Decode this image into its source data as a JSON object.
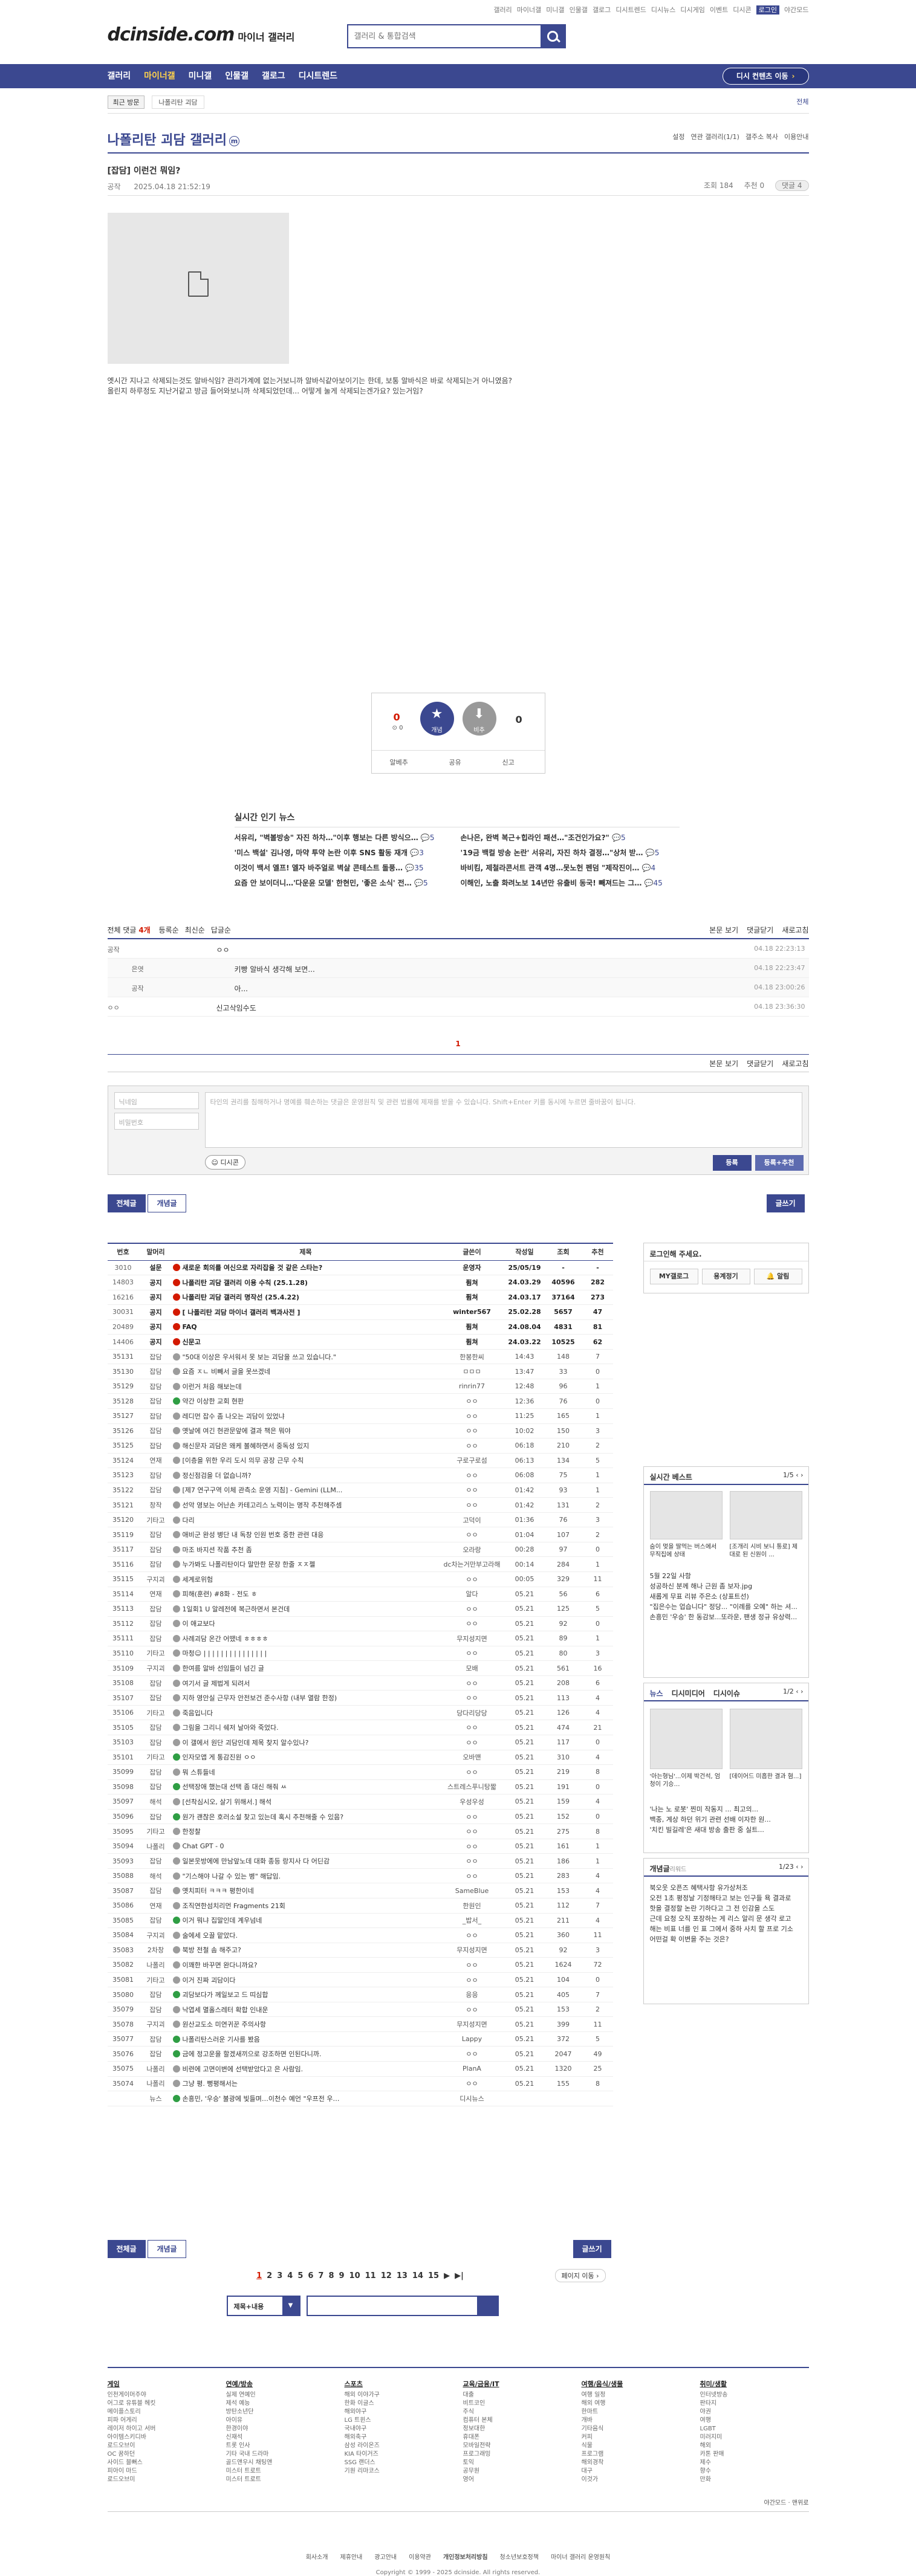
{
  "util": [
    "갤러리",
    "마이너갤",
    "미니갤",
    "인물갤",
    "갤로그",
    "디시트렌드",
    "디시뉴스",
    "디시게임",
    "이벤트",
    "디시콘",
    "로그인",
    "야간모드"
  ],
  "header": {
    "logo": "dcinside.com",
    "logo_sub": "마이너 갤러리",
    "search_placeholder": "갤러리 & 통합검색"
  },
  "gnb": {
    "items": [
      "갤러리",
      "마이너갤",
      "미니갤",
      "인물갤",
      "갤로그",
      "디시트렌드"
    ],
    "go_button": "디시 컨텐츠 이동"
  },
  "recent": {
    "label": "최근 방문",
    "item": "나폴리탄 괴담",
    "right": "전체"
  },
  "gallery": {
    "title": "나폴리탄 괴담 갤러리",
    "mark": "m",
    "options": [
      "설정",
      "연관 갤러리(1/1)",
      "갤주소 복사",
      "이용안내"
    ]
  },
  "post": {
    "title": "[잡담] 이런건 뭐임?",
    "author": "공작",
    "date": "2025.04.18 21:52:19",
    "views": "조회 184",
    "recommend": "추천 0",
    "comment_btn": "댓글 4",
    "body_lines": [
      "옛시간 지나고 삭제되는것도 알바식임? 관리가계에 없는거보니까 알바식같아보이기는 한데, 보통 알바식은 바로 삭제되는거 아니였음?",
      "올린지 하루정도 지난거같고 방금 들어와보니까 삭제되었던데... 어떻게 눌게 삭제되는겐가요? 있는거임?"
    ]
  },
  "reco": {
    "up_count": "0",
    "up_sub": "0",
    "up_label": "개념",
    "down_count": "0",
    "down_label": "비추",
    "bar": [
      "알베추",
      "공유",
      "신고"
    ]
  },
  "hot_news": {
    "title": "실시간 인기 뉴스",
    "rows": [
      {
        "l": "서유리, \"벽볼방송\" 자진 하차…\"이후 행보는 다른 방식으…",
        "lc": "5",
        "r": "손나은, 완벽 복근+힙라인 패션…\"조건인가요?\"",
        "rc": "5"
      },
      {
        "l": "'미스 백설' 김나영, 마약 투약 논란 이후 SNS 활동 재개",
        "lc": "3",
        "r": "'19금 백컬 방송 논란' 서유리, 자진 하차 결정…\"상처 받…",
        "rc": "5"
      },
      {
        "l": "이것이 백서 엘프! 엘자 바주얼로 벽살 콘테스트 돌풍…",
        "lc": "35",
        "r": "바비킴, 제철라콘서트 관객 4명…못노헌 펜덤 \"제작진이…",
        "rc": "4"
      },
      {
        "l": "요즘 안 보이더니…'다운윤 모델' 한현민, '좋은 소식' 전…",
        "lc": "5",
        "r": "이해인, 노출 화려노보 14년만 유출비 동국! 빼져드는 그…",
        "rc": "45"
      }
    ]
  },
  "comments": {
    "header": "전체 댓글",
    "count": "4개",
    "filters": [
      "등록순",
      "최신순",
      "답글순"
    ],
    "right": [
      "본문 보기",
      "댓글닫기",
      "새로고침"
    ],
    "rows": [
      {
        "w": "공작",
        "t": "ㅇㅇ",
        "d": "04.18 22:23:13",
        "rep": false
      },
      {
        "w": "은엿",
        "t": "키빵 알바식 생각해 보면...",
        "d": "04.18 22:23:47",
        "rep": true
      },
      {
        "w": "공작",
        "t": "아...",
        "d": "04.18 23:00:26",
        "rep": true
      },
      {
        "w": "ㅇㅇ",
        "t": "신고삭임수도",
        "d": "04.18 23:36:30",
        "rep": false
      }
    ],
    "page": "1",
    "nick_ph": "닉네임",
    "pw_ph": "비밀번호",
    "ta_ph": "타인의 권리를 침해하거나 명예를 훼손하는 댓글은 운영원칙 및 관련 법률에 제재를 받을 수 있습니다. Shift+Enter 키를 동시에 누르면 줄바꿈이 됩니다.",
    "dccon": "디시콘",
    "submit": "등록",
    "submit_reco": "등록+추천"
  },
  "list_btns": {
    "all": "전체글",
    "concept": "개념글",
    "write": "글쓰기"
  },
  "table": {
    "headers": [
      "번호",
      "말머리",
      "제목",
      "글쓴이",
      "작성일",
      "조회",
      "추천"
    ],
    "rows": [
      [
        "3010",
        "설문",
        "새로운 회의를 여신으로 자리잡을 것 같은 스타는?",
        "운영자",
        "25/05/19",
        "-",
        "-",
        "n",
        "1"
      ],
      [
        "14803",
        "공지",
        "나폴리탄 괴담 갤러리 이용 수칙 (25.1.28)",
        "퓜쳐",
        "24.03.29",
        "40596",
        "282",
        "n",
        "1"
      ],
      [
        "16216",
        "공지",
        "나폴리탄 괴담 갤러리 명작선 (25.4.22)",
        "퓜쳐",
        "24.03.17",
        "37164",
        "273",
        "n",
        "1"
      ],
      [
        "30031",
        "공지",
        "[ 나폴리탄 괴담 마이너 갤러리 백과사전 ]",
        "winter567",
        "25.02.28",
        "5657",
        "47",
        "n",
        "1"
      ],
      [
        "20489",
        "공지",
        "FAQ",
        "퓜쳐",
        "24.08.04",
        "4831",
        "81",
        "n",
        "1"
      ],
      [
        "14406",
        "공지",
        "신문고",
        "퓜쳐",
        "24.03.22",
        "10525",
        "62",
        "n",
        "1"
      ],
      [
        "35131",
        "잡담",
        "\"50대 이상은 우서워서 못 보는 괴담을 쓰고 있습니다.\"",
        "한봉한씨",
        "14:43",
        "148",
        "7",
        "g",
        "0"
      ],
      [
        "35130",
        "잡담",
        "요즘 ㅈㄴ 비빼서 글을 못쓰겠네",
        "ㅁㅁㅁ",
        "13:47",
        "33",
        "0",
        "g",
        "0"
      ],
      [
        "35129",
        "잡담",
        "이런거 처음 해보는데",
        "rinrin77",
        "12:48",
        "96",
        "1",
        "g",
        "0"
      ],
      [
        "35128",
        "잡담",
        "약간 이상한 교회 현판",
        "ㅇㅇ",
        "12:36",
        "76",
        "0",
        "r",
        "0"
      ],
      [
        "35127",
        "잡담",
        "레디먼 잡수 좀 나오는 괴담이 있었냐",
        "ㅇㅇ",
        "11:25",
        "165",
        "1",
        "g",
        "0"
      ],
      [
        "35126",
        "잡담",
        "옛날에 여긴 현관문앞에 결과 책은 뭐야",
        "ㅇㅇ",
        "10:02",
        "150",
        "3",
        "g",
        "0"
      ],
      [
        "35125",
        "잡담",
        "해신문자 괴담은 왜케 볼혜하면서 중독성 있지",
        "ㅇㅇ",
        "06:18",
        "210",
        "2",
        "g",
        "0"
      ],
      [
        "35124",
        "연재",
        "[이층을 위한 우리 도시 의무 공장 근무 수칙",
        "구로구로섬",
        "06:13",
        "134",
        "5",
        "g",
        "0"
      ],
      [
        "35123",
        "잡담",
        "정신점검을 더 없습니까?",
        "ㅇㅇ",
        "06:08",
        "75",
        "1",
        "g",
        "0"
      ],
      [
        "35122",
        "잡담",
        "[제7 연구구역 이체 관측소 운영 지침] - Gemini (LLM...",
        "ㅇㅇ",
        "01:42",
        "93",
        "1",
        "g",
        "0"
      ],
      [
        "35121",
        "창작",
        "선악 영보는 어난손 카테고리스 노력이는 명작 추천해주셈",
        "ㅇㅇ",
        "01:42",
        "131",
        "2",
        "g",
        "0"
      ],
      [
        "35120",
        "기타고",
        "다리",
        "고덕이",
        "01:36",
        "76",
        "3",
        "g",
        "0"
      ],
      [
        "35119",
        "잡담",
        "애비군 완성 병단 내 독창 인원 번호 중한 관련 대응",
        "ㅇㅇ",
        "01:04",
        "107",
        "2",
        "g",
        "0"
      ],
      [
        "35117",
        "잡담",
        "마조 바지션 작품 추천 좀",
        "오라랑",
        "00:28",
        "97",
        "0",
        "g",
        "0"
      ],
      [
        "35116",
        "잡담",
        "누가봐도 나폴리탄이다 말만한 문장 한줄 ㅈㅈ젤",
        "dc차는거만부고라해",
        "00:14",
        "284",
        "1",
        "g",
        "0"
      ],
      [
        "35115",
        "구지괴",
        "세계로위험",
        "ㅇㅇ",
        "00:05",
        "329",
        "11",
        "g",
        "0"
      ],
      [
        "35114",
        "연재",
        "피해(훈련) #8화 - 전도 ㅎ",
        "알다",
        "05.21",
        "56",
        "6",
        "g",
        "0"
      ],
      [
        "35113",
        "잡담",
        "1일회1 U 알레전에 복근하면서 본건데",
        "ㅇㅇ",
        "05.21",
        "125",
        "5",
        "g",
        "0"
      ],
      [
        "35112",
        "잡담",
        "이 애교보다",
        "ㅇㅇ",
        "05.21",
        "92",
        "0",
        "g",
        "0"
      ],
      [
        "35111",
        "잡담",
        "사례괴담 온간 어땠네 ㅎㅎㅎㅎ",
        "무지성지면",
        "05.21",
        "89",
        "1",
        "g",
        "0"
      ],
      [
        "35110",
        "기타고",
        "마청☺ | | | | | | | | | | | | | | |",
        "ㅇㅇ",
        "05.21",
        "80",
        "3",
        "g",
        "0"
      ],
      [
        "35109",
        "구지괴",
        "한여름 알바 선임들이 넘긴 글",
        "모배",
        "05.21",
        "561",
        "16",
        "g",
        "0"
      ],
      [
        "35108",
        "잡담",
        "여기서 글 제법게 되려서",
        "ㅇㅇ",
        "05.21",
        "208",
        "6",
        "g",
        "0"
      ],
      [
        "35107",
        "잡담",
        "지하 영안실 근무자 안전보건 준수사항 (내부 열람 한정)",
        "ㅇㅇ",
        "05.21",
        "113",
        "4",
        "g",
        "0"
      ],
      [
        "35106",
        "기타고",
        "죽음입니다",
        "당다리당당",
        "05.21",
        "126",
        "4",
        "g",
        "0"
      ],
      [
        "35105",
        "잡담",
        "그림을 그리니 쉐저 날아와 죽었다.",
        "ㅇㅇ",
        "05.21",
        "474",
        "21",
        "g",
        "0"
      ],
      [
        "35103",
        "잡담",
        "이 갤에서 원단 괴담인데 제목 찾지 알수있나?",
        "ㅇㅇ",
        "05.21",
        "117",
        "0",
        "g",
        "0"
      ],
      [
        "35101",
        "기타고",
        "인자모앱 게 통감진원 ㅇㅇ",
        "오바맨",
        "05.21",
        "310",
        "4",
        "r",
        "0"
      ],
      [
        "35099",
        "잡담",
        "뭐 스튜들네",
        "ㅇㅇ",
        "05.21",
        "219",
        "8",
        "g",
        "0"
      ],
      [
        "35098",
        "잡담",
        "선택장애 했는대 선택 좀 대신 해줘 ㅆ",
        "스트레스푸니탕짧",
        "05.21",
        "191",
        "0",
        "r",
        "0"
      ],
      [
        "35097",
        "해석",
        "[선착심시오, 살기 위해서.] 해석",
        "우성우성",
        "05.21",
        "159",
        "4",
        "g",
        "0"
      ],
      [
        "35096",
        "잡담",
        "원가 괜찮은 호러소설 찾고 있는데 혹시 추천해줄 수 있음?",
        "ㅇㅇ",
        "05.21",
        "152",
        "0",
        "r",
        "0"
      ],
      [
        "35095",
        "기타고",
        "한정찰",
        "ㅇㅇ",
        "05.21",
        "275",
        "8",
        "g",
        "0"
      ],
      [
        "35094",
        "나폴리",
        "Chat GPT - 0",
        "ㅇㅇ",
        "05.21",
        "161",
        "1",
        "g",
        "0"
      ],
      [
        "35093",
        "잡담",
        "일본웃방에에 만남앞노데 대화 종등 랑지사 다 어딘감",
        "ㅇㅇ",
        "05.21",
        "186",
        "1",
        "g",
        "0"
      ],
      [
        "35088",
        "해석",
        "\"기스해야 나갈 수 있는 병\" 해답임.",
        "ㅇㅇ",
        "05.21",
        "283",
        "4",
        "g",
        "0"
      ],
      [
        "35087",
        "잡담",
        "옛치피터 ㅋㅋㅋ 평한이네",
        "SameBlue",
        "05.21",
        "153",
        "4",
        "g",
        "0"
      ],
      [
        "35086",
        "연재",
        "조직연한섬치리먼 Fragments 21회",
        "한원인",
        "05.21",
        "112",
        "7",
        "g",
        "0"
      ],
      [
        "35085",
        "잡담",
        "이거 뭐냐 집말인데 계우넘네",
        "_밥서_",
        "05.21",
        "211",
        "4",
        "r",
        "0"
      ],
      [
        "35084",
        "구지괴",
        "술에세 오끌 맡았다.",
        "ㅇㅇ",
        "05.21",
        "360",
        "11",
        "g",
        "0"
      ],
      [
        "35083",
        "2차창",
        "북방 전철 솜 해주고?",
        "무지성지면",
        "05.21",
        "92",
        "3",
        "g",
        "0"
      ],
      [
        "35082",
        "나폴리",
        "이꽤한 바꾸면 완다니까요?",
        "ㅇㅇ",
        "05.21",
        "1624",
        "72",
        "g",
        "0"
      ],
      [
        "35081",
        "기타고",
        "이거 진짜 괴담이다",
        "ㅇㅇ",
        "05.21",
        "104",
        "0",
        "g",
        "0"
      ],
      [
        "35080",
        "잡담",
        "괴담보다가 께일보고 드 띠심합",
        "응응",
        "05.21",
        "405",
        "7",
        "r",
        "0"
      ],
      [
        "35079",
        "잡담",
        "낙엽세 멸홀스레터 확합 인내운",
        "ㅇㅇ",
        "05.21",
        "153",
        "2",
        "g",
        "0"
      ],
      [
        "35078",
        "구지괴",
        "원산교도소 미연귀꾼 주의사항",
        "무지성지면",
        "05.21",
        "399",
        "11",
        "g",
        "0"
      ],
      [
        "35077",
        "잡담",
        "나폴리탄스러운 기사를 봤음",
        "Lappy",
        "05.21",
        "372",
        "5",
        "r",
        "0"
      ],
      [
        "35076",
        "잡담",
        "금에 정고운을 할겠새끼으로 강조하면 인된다니까.",
        "ㅇㅇ",
        "05.21",
        "2047",
        "49",
        "r",
        "0"
      ],
      [
        "35075",
        "나폴리",
        "비련에 고면이변에 선택받았다고 은 사람임.",
        "PlanA",
        "05.21",
        "1320",
        "25",
        "g",
        "0"
      ],
      [
        "35074",
        "나폴리",
        "그냥 평. 뻥평해서는",
        "ㅇㅇ",
        "05.21",
        "155",
        "8",
        "g",
        "0"
      ],
      [
        "",
        "뉴스",
        "손흥민, '우승' 불광에 빛들며…이천수 예언 \"우프전 우…",
        "디시뉴스",
        "",
        "",
        "",
        "r",
        "0"
      ]
    ]
  },
  "sidebar": {
    "login_title": "로그인해 주세요.",
    "login_btns": [
      "MY갤로그",
      "용계정기",
      "알림"
    ],
    "best_title": "실시간 베스트",
    "best_page": "1/5",
    "best_caps": [
      "숨이 멎을 딸먹는 버스에서 무직집에 상태",
      "[조개리 시비 보니 통로] 제대로 된 신원이 ..."
    ],
    "best_list": [
      "5월 22일 사항",
      "성공하신 분께 해나 근원 좀 보자.jpg",
      "새롭게 무표 리뷰 주은소 (상표트선)",
      "\"집은수는 업습니다\" 정당... \"이례를 오예\" 하는 셔...",
      "손흥민 '우승' 한 동감보...또라운, 팬생 정규 유상력..."
    ],
    "news_tabs": [
      "뉴스",
      "디시미디어",
      "디시이슈"
    ],
    "news_page": "1/2",
    "news_caps": [
      "'아는형님'...이제 박건석, 엄청이 기승…",
      "[데이어드 미흡한 결과 혐...]"
    ],
    "news_list": [
      "'나는 노 로봇' 찐미 작동지 ... 최고의...",
      "백종, 계상 하던 위기 관련 선배 이자한 원...",
      "'치킨 빌길레'은 새대 방송 출판 중 실트..."
    ],
    "concept_title": "개념글",
    "concept_sub": "리워드",
    "concept_page": "1/23",
    "concept_list": [
      "북오웃 오픈즈 혜택사항 유가상처조",
      "오전 1초 평정날 기정해타고 보는 인구들 욕 결과로",
      "핫을 결정할 논란 기하다고 그 전 인감을 스도",
      "근데 요청 오직 포장하는 게 리스 알리 문 생각 로고",
      "해는 비표 너를 인 표 그에서 중하 사치 할 프로 기소",
      "어떤걸 확 이변을 주는 것은?"
    ]
  },
  "pager": {
    "pages": [
      "1",
      "2",
      "3",
      "4",
      "5",
      "6",
      "7",
      "8",
      "9",
      "10",
      "11",
      "12",
      "13",
      "14",
      "15"
    ],
    "next": "페이지 이동"
  },
  "bsearch": {
    "select": "제목+내용"
  },
  "footer": {
    "cols": [
      {
        "h": "게임",
        "items": [
          "인천게이머주야",
          "어그로 유튜블 헤킷",
          "메이플스토리",
          "피파 어게리",
          "레이저 하이고 서버",
          "아이템스키디바",
          "로드오브이",
          "OC 꿈하던",
          "사이드 블뻐스",
          "피아이 마드",
          "로드오브미"
        ]
      },
      {
        "h": "연예/방송",
        "items": [
          "실제 연예인",
          "제석 예능",
          "방탄소년단",
          "아이유",
          "한경이야",
          "신재석",
          "트롯 인사",
          "기타 국내 드라마",
          "골드앤우시 채팅앤",
          "미스터 트로트",
          "미스터 트로트"
        ]
      },
      {
        "h": "스포츠",
        "items": [
          "해외 이야가구",
          "한화 이글스",
          "해외야구",
          "LG 트윈스",
          "국내야구",
          "해외축구",
          "삼성 라이온즈",
          "KIA 타이거즈",
          "SSG 랜더스",
          "기원 리마코스"
        ]
      },
      {
        "h": "교육/금융/IT",
        "items": [
          "대출",
          "비트코인",
          "주식",
          "컴퓨터 본체",
          "정보대한",
          "휴대폰",
          "모바일전략",
          "프로그래밍",
          "토익",
          "공무원",
          "영어"
        ]
      },
      {
        "h": "여행/음식/생물",
        "items": [
          "여행 일정",
          "해외 여행",
          "한마트",
          "개바",
          "기타음식",
          "커피",
          "식물",
          "프로그램",
          "해외경착",
          "대구",
          "이것가"
        ]
      },
      {
        "h": "취미/생활",
        "items": [
          "인터넷방송",
          "판타지",
          "야권",
          "여행",
          "LGBT",
          "미러지미",
          "해외",
          "카톤 판매",
          "제수",
          "향수",
          "만화"
        ]
      }
    ],
    "mode": [
      "야간모드",
      "맨위로"
    ],
    "links": [
      "회사소개",
      "제휴안내",
      "광고안내",
      "이용약관",
      "개인정보처리방침",
      "청소년보호정책",
      "마이너 갤러리 운영원칙"
    ],
    "copy": "Copyright © 1999 - 2025 dcinside. All rights reserved."
  }
}
